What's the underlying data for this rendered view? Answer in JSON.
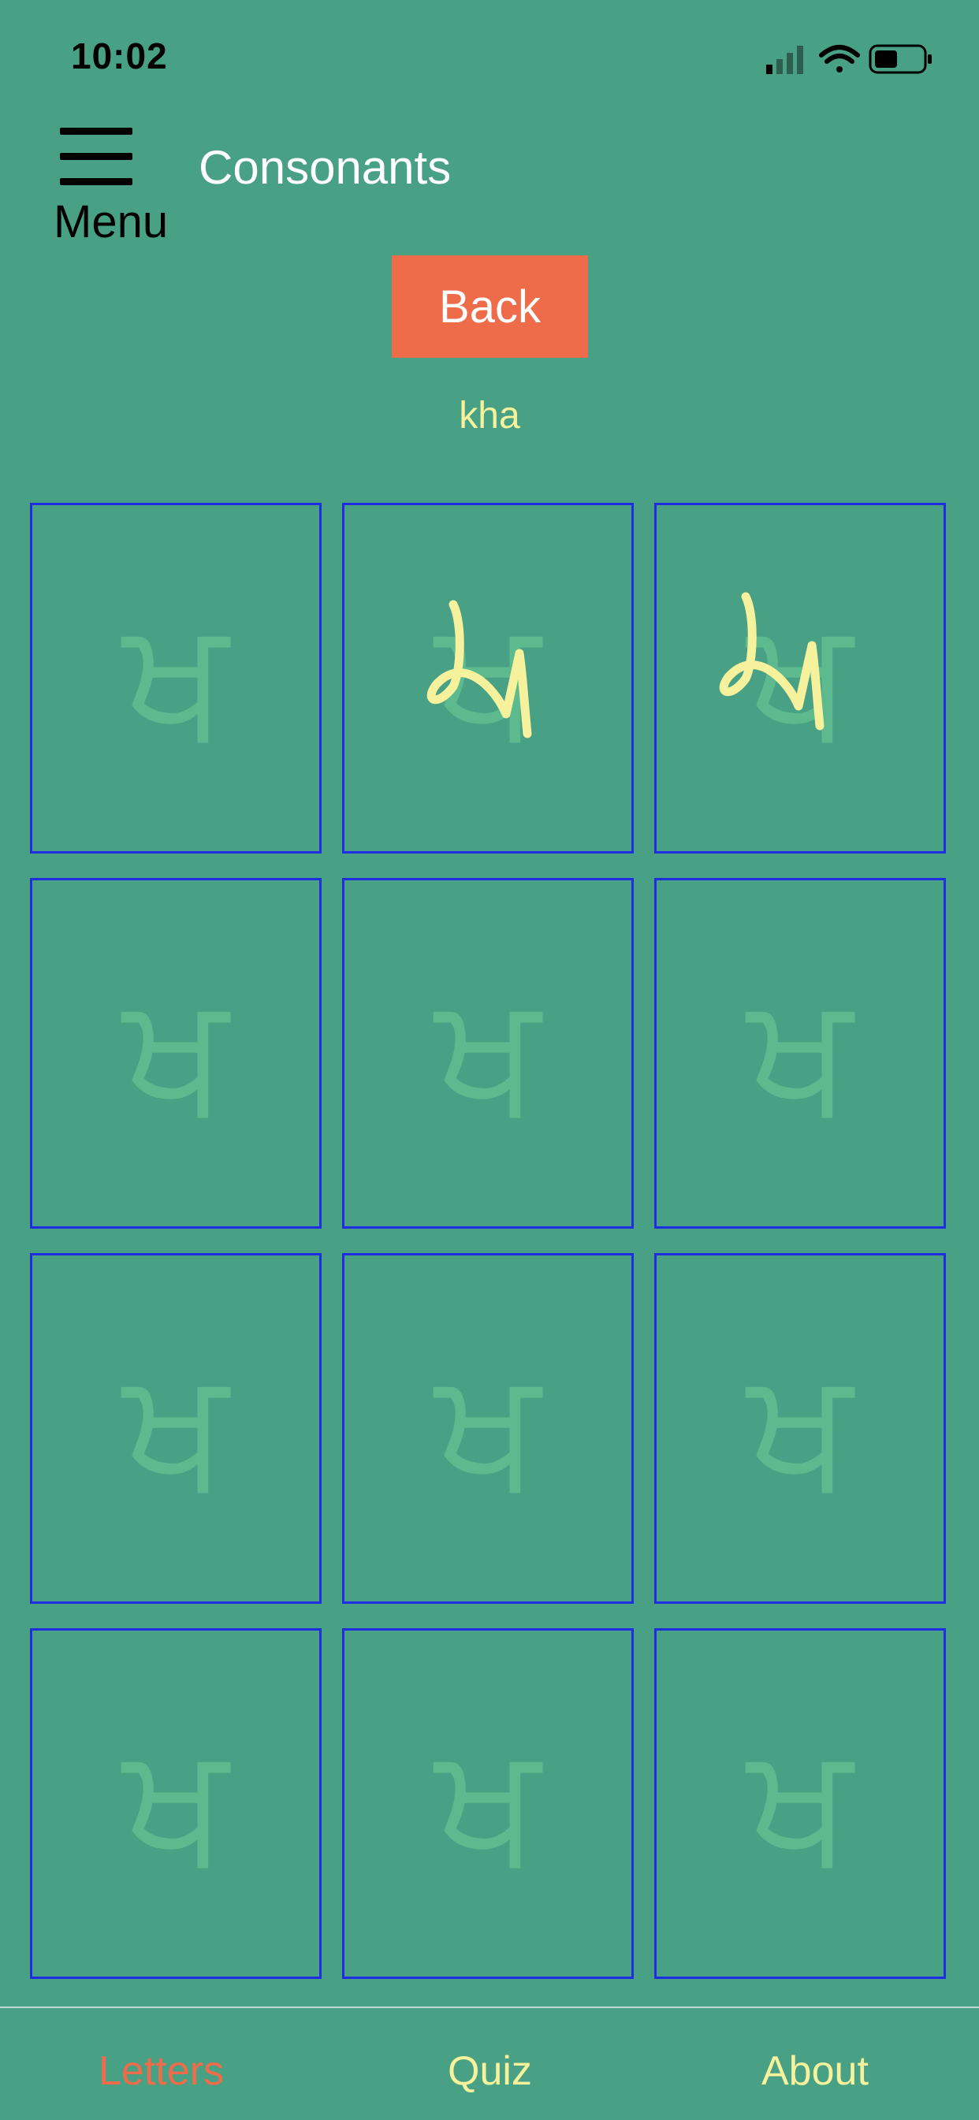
{
  "status_bar": {
    "time": "10:02",
    "icons": [
      "signal-icon",
      "wifi-icon",
      "battery-icon"
    ]
  },
  "header": {
    "menu_icon": "hamburger-menu-icon",
    "menu_label": "Menu",
    "title": "Consonants"
  },
  "back_button": {
    "label": "Back",
    "color": "#ee6c4a"
  },
  "letter": {
    "name": "kha",
    "guide_glyph": "ਖ",
    "cells": [
      {
        "traced": false
      },
      {
        "traced": true
      },
      {
        "traced": true
      },
      {
        "traced": false
      },
      {
        "traced": false
      },
      {
        "traced": false
      },
      {
        "traced": false
      },
      {
        "traced": false
      },
      {
        "traced": false
      },
      {
        "traced": false
      },
      {
        "traced": false
      },
      {
        "traced": false
      }
    ]
  },
  "tabs": [
    {
      "label": "Letters",
      "active": true
    },
    {
      "label": "Quiz",
      "active": false
    },
    {
      "label": "About",
      "active": false
    }
  ],
  "colors": {
    "background": "#48a085",
    "guide_glyph": "#5dba8e",
    "cell_border": "#1f2ce0",
    "trace_stroke": "#f5f19c",
    "accent": "#ee6c4a"
  }
}
